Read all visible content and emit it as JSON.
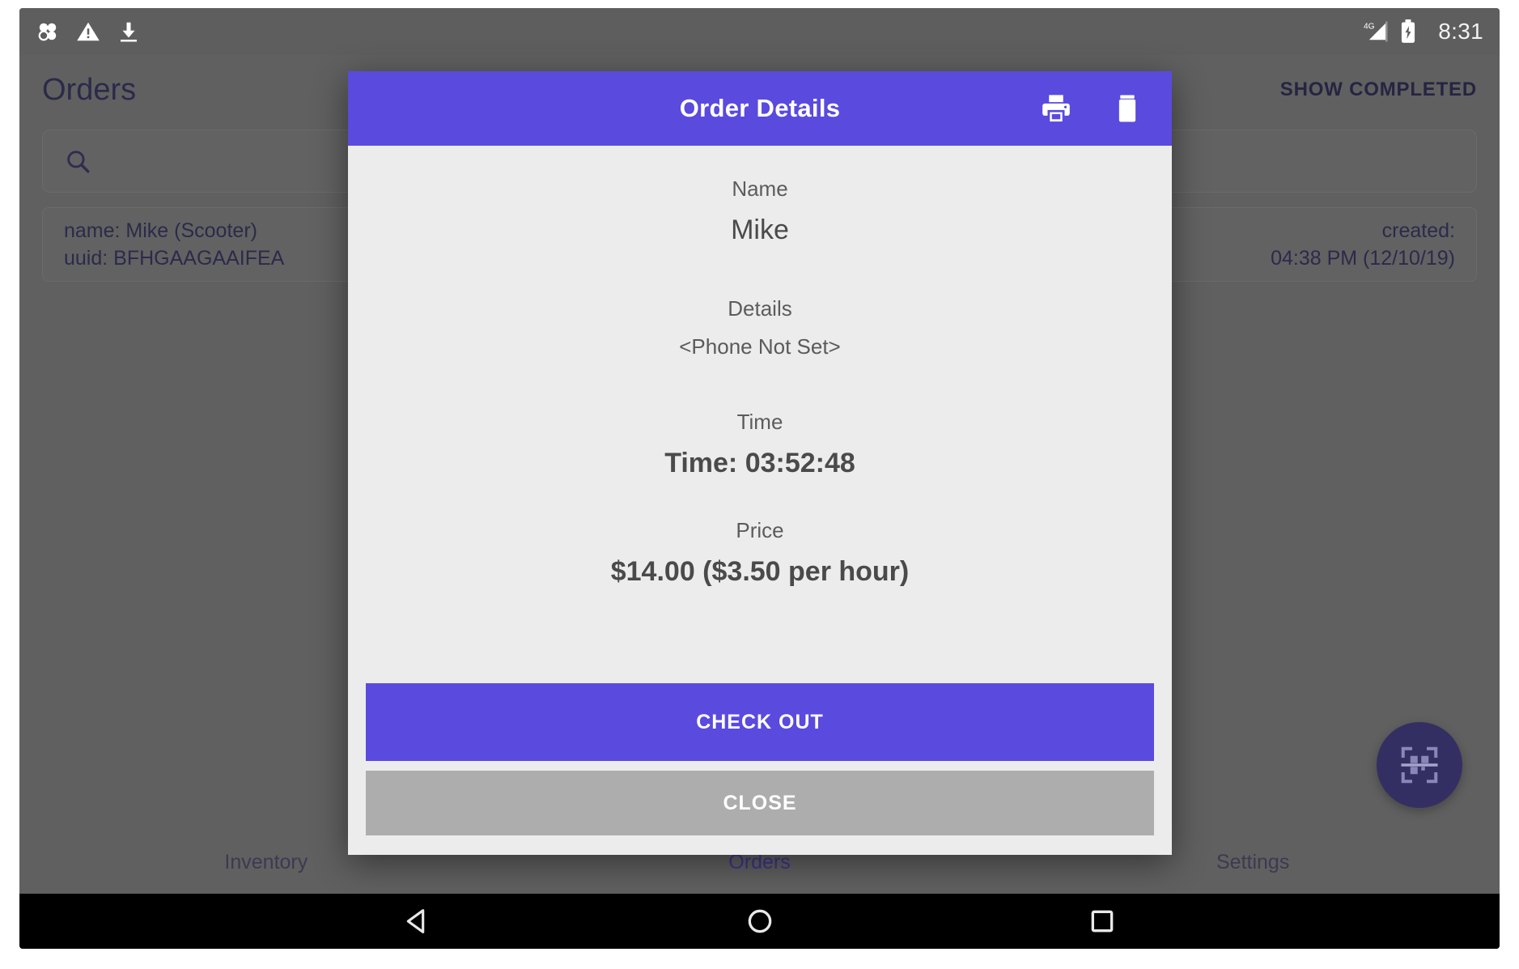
{
  "statusbar": {
    "icons": [
      "apps-icon",
      "warning-icon",
      "download-icon"
    ],
    "network_label": "4G",
    "battery": "battery-charging-icon",
    "time": "8:31"
  },
  "app": {
    "title": "Orders",
    "show_completed_label": "SHOW COMPLETED",
    "search": {
      "placeholder": "",
      "value": "",
      "icon": "search-icon"
    },
    "orders": [
      {
        "name_line": "name: Mike (Scooter)",
        "uuid_line": "uuid: BFHGAAGAAIFEA",
        "created_label": "created:",
        "created_value": "04:38 PM (12/10/19)"
      }
    ],
    "fab": {
      "icon": "qr-scan-icon"
    },
    "bottom_nav": [
      {
        "label": "Inventory",
        "active": false
      },
      {
        "label": "Orders",
        "active": true
      },
      {
        "label": "Settings",
        "active": false
      }
    ]
  },
  "dialog": {
    "title": "Order Details",
    "actions": {
      "print_icon": "printer-icon",
      "delete_icon": "trash-icon"
    },
    "fields": [
      {
        "label": "Name",
        "value": "Mike",
        "emphasis": "normal"
      },
      {
        "label": "Details",
        "value": "<Phone Not Set>",
        "emphasis": "small"
      },
      {
        "label": "Time",
        "value": "Time: 03:52:48",
        "emphasis": "bold"
      },
      {
        "label": "Price",
        "value": "$14.00 ($3.50 per hour)",
        "emphasis": "bold"
      }
    ],
    "primary_button": "CHECK OUT",
    "secondary_button": "CLOSE"
  },
  "android_nav": {
    "back": "back-triangle-icon",
    "home": "home-circle-icon",
    "recents": "recents-square-icon"
  },
  "colors": {
    "accent_purple": "#5a4ade",
    "dialog_bg": "#ececec",
    "secondary_button": "#adadad",
    "screen_dim": "#606060"
  }
}
